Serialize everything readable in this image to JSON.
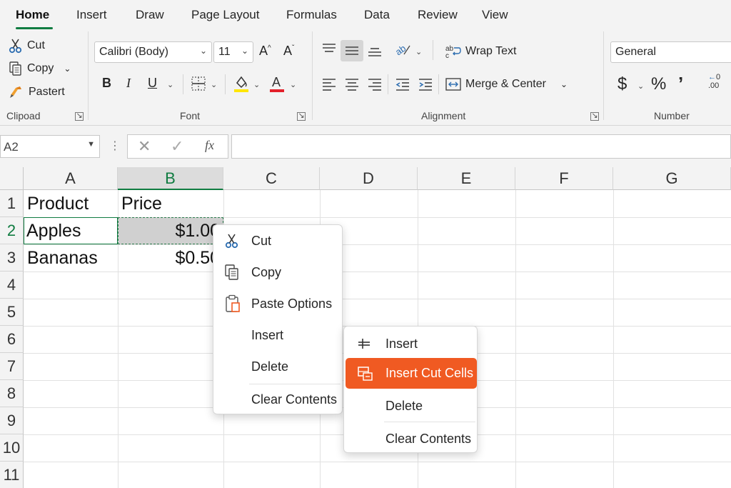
{
  "ribbon_tabs": [
    {
      "label": "Home",
      "active": true
    },
    {
      "label": "Insert"
    },
    {
      "label": "Draw"
    },
    {
      "label": "Page Layout"
    },
    {
      "label": "Formulas"
    },
    {
      "label": "Data"
    },
    {
      "label": "Review"
    },
    {
      "label": "View"
    }
  ],
  "clipboard": {
    "cut": "Cut",
    "copy": "Copy",
    "paste": "Pastert",
    "label": "Clipoad"
  },
  "font": {
    "name": "Calibri (Body)",
    "size": "11",
    "label": "Font"
  },
  "alignment": {
    "wrap": "Wrap Text",
    "merge": "Merge & Center",
    "label": "Alignment"
  },
  "number": {
    "format": "General",
    "label": "Number"
  },
  "formula_bar": {
    "name_box": "A2",
    "formula": ""
  },
  "sheet": {
    "columns": [
      "A",
      "B",
      "C",
      "D",
      "E",
      "F",
      "G"
    ],
    "rows": [
      "1",
      "2",
      "3",
      "4",
      "5",
      "6",
      "7",
      "8",
      "9",
      "10",
      "11"
    ],
    "cells": {
      "a1": "Product",
      "b1": "Price",
      "a2": "Apples",
      "b2": "$1.00",
      "a3": "Bananas",
      "b3": "$0.50"
    }
  },
  "context_menu": {
    "items": [
      "Cut",
      "Copy",
      "Paste Options",
      "Insert",
      "Delete",
      "Clear Contents"
    ]
  },
  "submenu": {
    "items": [
      "Insert",
      "Insert Cut Cells",
      "Delete",
      "Clear Contents"
    ],
    "highlighted": "Insert Cut Cells",
    "highlight_color": "#f05a22"
  },
  "colors": {
    "accent": "#107c41",
    "ribbon_bg": "#f3f3f3"
  }
}
